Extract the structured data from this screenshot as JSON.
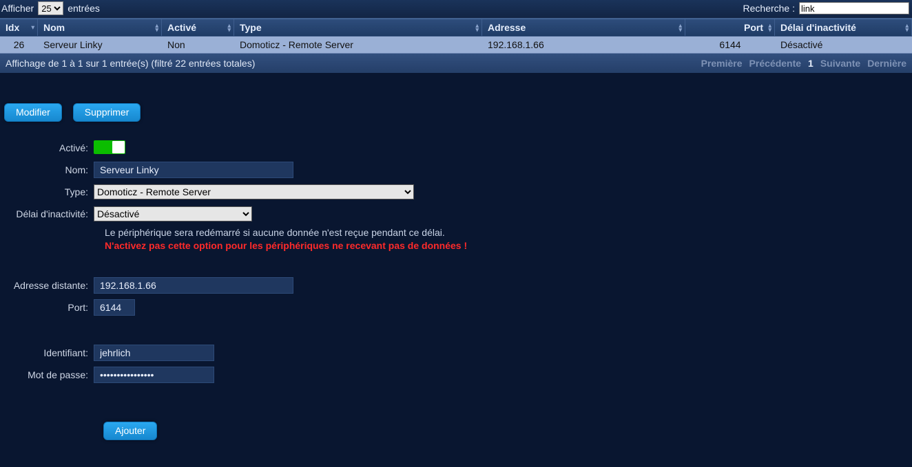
{
  "topbar": {
    "show_label_pre": "Afficher",
    "show_label_post": "entrées",
    "entries_value": "25",
    "search_label": "Recherche :",
    "search_value": "link"
  },
  "columns": {
    "idx": "Idx",
    "nom": "Nom",
    "active": "Activé",
    "type": "Type",
    "addr": "Adresse",
    "port": "Port",
    "delay": "Délai d'inactivité"
  },
  "row": {
    "idx": "26",
    "nom": "Serveur Linky",
    "active": "Non",
    "type": "Domoticz - Remote Server",
    "addr": "192.168.1.66",
    "port": "6144",
    "delay": "Désactivé"
  },
  "footer": {
    "info": "Affichage de 1 à 1 sur 1 entrée(s) (filtré 22 entrées totales)",
    "first": "Première",
    "prev": "Précédente",
    "page": "1",
    "next": "Suivante",
    "last": "Dernière"
  },
  "actions": {
    "modify": "Modifier",
    "delete": "Supprimer",
    "add": "Ajouter"
  },
  "form": {
    "labels": {
      "active": "Activé:",
      "nom": "Nom:",
      "type": "Type:",
      "delay": "Délai d'inactivité:",
      "remote": "Adresse distante:",
      "port": "Port:",
      "user": "Identifiant:",
      "pass": "Mot de passe:"
    },
    "values": {
      "nom": "Serveur Linky",
      "type": "Domoticz - Remote Server",
      "delay": "Désactivé",
      "remote": "192.168.1.66",
      "port": "6144",
      "user": "jehrlich",
      "pass": "••••••••••••••••"
    },
    "info": "Le périphérique sera redémarré si aucune donnée n'est reçue pendant ce délai.",
    "warn": "N'activez pas cette option pour les périphériques ne recevant pas de données !"
  }
}
